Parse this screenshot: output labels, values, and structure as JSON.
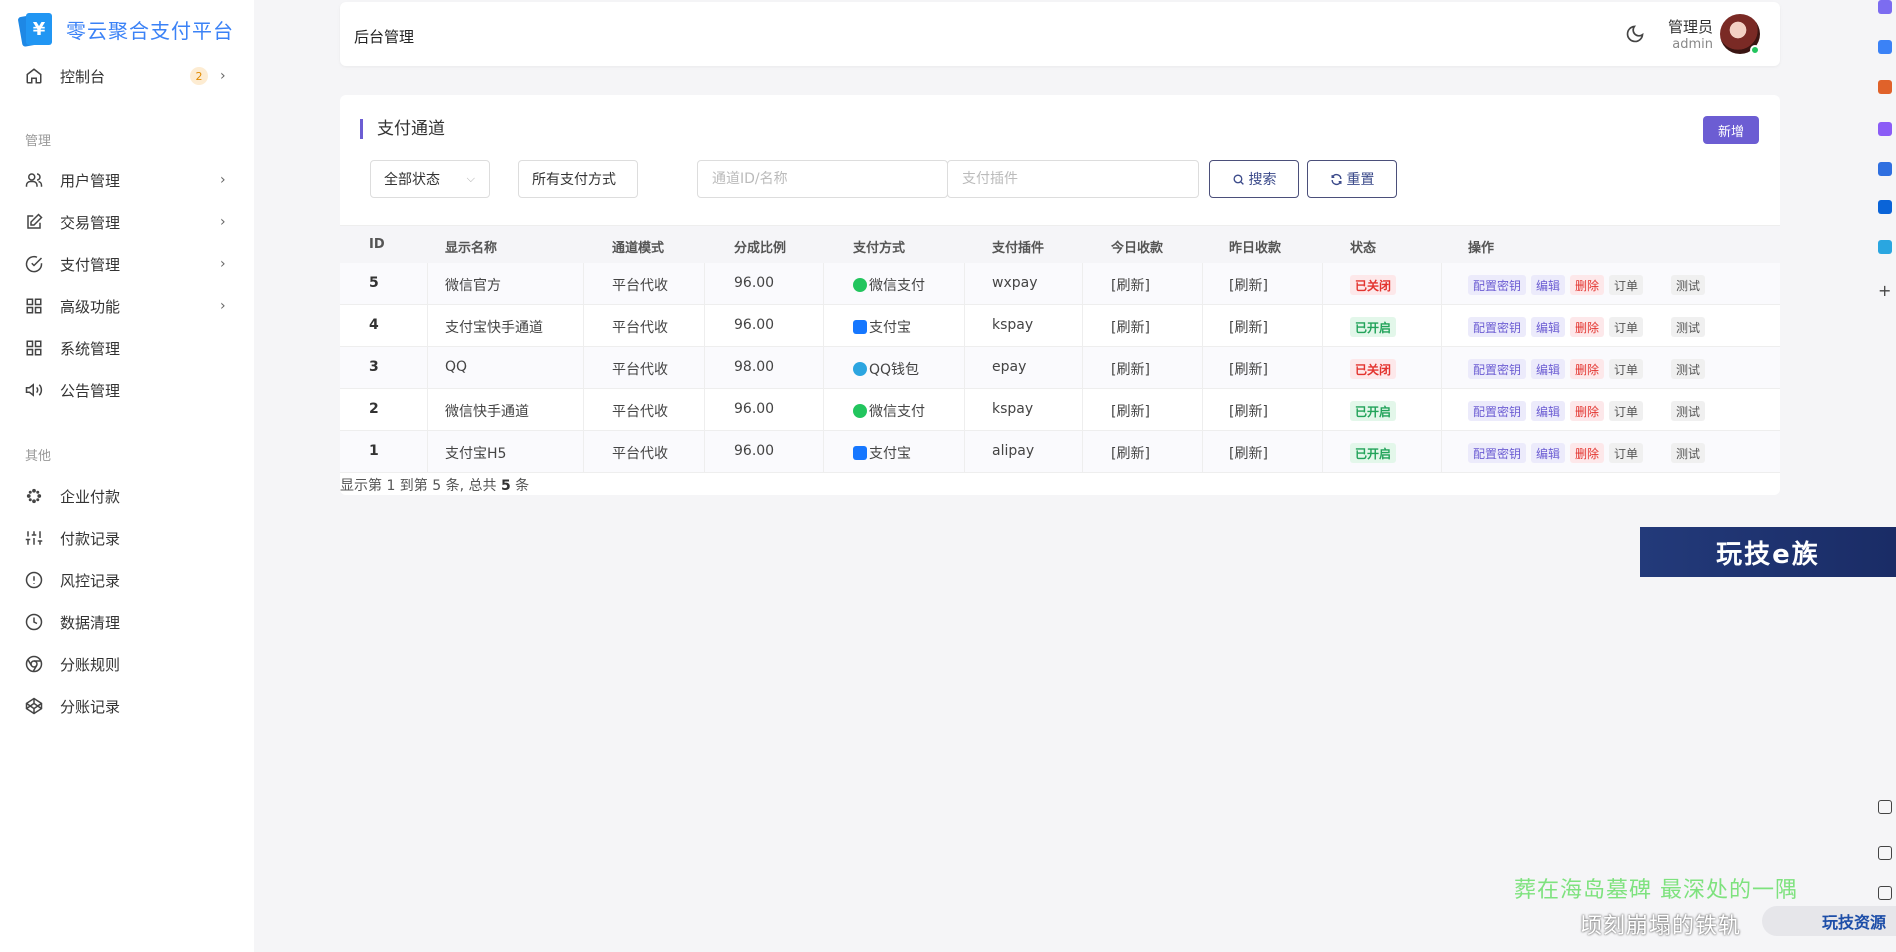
{
  "brand": {
    "title": "零云聚合支付平台"
  },
  "sidebar": {
    "dashboard": {
      "label": "控制台",
      "badge": "2"
    },
    "section_manage": "管理",
    "manage_items": [
      {
        "label": "用户管理",
        "icon": "users-icon",
        "has_children": true
      },
      {
        "label": "交易管理",
        "icon": "edit-icon",
        "has_children": true
      },
      {
        "label": "支付管理",
        "icon": "check-circle-icon",
        "has_children": true
      },
      {
        "label": "高级功能",
        "icon": "grid-icon",
        "has_children": true
      },
      {
        "label": "系统管理",
        "icon": "grid-icon",
        "has_children": false
      },
      {
        "label": "公告管理",
        "icon": "speaker-icon",
        "has_children": false
      }
    ],
    "section_other": "其他",
    "other_items": [
      {
        "label": "企业付款",
        "icon": "dots-icon"
      },
      {
        "label": "付款记录",
        "icon": "sliders-icon"
      },
      {
        "label": "风控记录",
        "icon": "alert-circle-icon"
      },
      {
        "label": "数据清理",
        "icon": "clock-icon"
      },
      {
        "label": "分账规则",
        "icon": "chrome-icon"
      },
      {
        "label": "分账记录",
        "icon": "codepen-icon"
      }
    ]
  },
  "header": {
    "title": "后台管理",
    "user_name": "管理员",
    "user_role": "admin"
  },
  "main": {
    "section_title": "支付通道",
    "new_button": "新增",
    "filters": {
      "status": "全部状态",
      "pay_type": "所有支付方式",
      "channel_placeholder": "通道ID/名称",
      "plugin_placeholder": "支付插件",
      "search_button": "搜索",
      "reset_button": "重置"
    },
    "columns": [
      "ID",
      "显示名称",
      "通道模式",
      "分成比例",
      "支付方式",
      "支付插件",
      "今日收款",
      "昨日收款",
      "状态",
      "操作"
    ],
    "rows": [
      {
        "id": "5",
        "name": "微信官方",
        "mode": "平台代收",
        "rate": "96.00",
        "pay": "微信支付",
        "pay_kind": "wx",
        "plugin": "wxpay",
        "today": "[刷新]",
        "yesterday": "[刷新]",
        "status": "已关闭",
        "status_kind": "off"
      },
      {
        "id": "4",
        "name": "支付宝快手通道",
        "mode": "平台代收",
        "rate": "96.00",
        "pay": "支付宝",
        "pay_kind": "ali",
        "plugin": "kspay",
        "today": "[刷新]",
        "yesterday": "[刷新]",
        "status": "已开启",
        "status_kind": "on"
      },
      {
        "id": "3",
        "name": "QQ",
        "mode": "平台代收",
        "rate": "98.00",
        "pay": "QQ钱包",
        "pay_kind": "qq",
        "plugin": "epay",
        "today": "[刷新]",
        "yesterday": "[刷新]",
        "status": "已关闭",
        "status_kind": "off"
      },
      {
        "id": "2",
        "name": "微信快手通道",
        "mode": "平台代收",
        "rate": "96.00",
        "pay": "微信支付",
        "pay_kind": "wx",
        "plugin": "kspay",
        "today": "[刷新]",
        "yesterday": "[刷新]",
        "status": "已开启",
        "status_kind": "on"
      },
      {
        "id": "1",
        "name": "支付宝H5",
        "mode": "平台代收",
        "rate": "96.00",
        "pay": "支付宝",
        "pay_kind": "ali",
        "plugin": "alipay",
        "today": "[刷新]",
        "yesterday": "[刷新]",
        "status": "已开启",
        "status_kind": "on"
      }
    ],
    "actions": {
      "config": "配置密钥",
      "edit": "编辑",
      "delete": "删除",
      "orders": "订单",
      "test": "测试"
    },
    "footer": {
      "prefix": "显示第 1 到第 5 条, 总共 ",
      "total": "5",
      "suffix": " 条"
    }
  },
  "overlay": {
    "banner": "玩技e族",
    "subtitle_1": "葬在海岛墓碑 最深处的一隅",
    "subtitle_2": "顷刻崩塌的铁轨",
    "watermark": "玩技资源"
  },
  "colors": {
    "accent": "#6c5dd3",
    "brand": "#3b82f6",
    "success": "#22a35a",
    "danger": "#e3342f"
  }
}
